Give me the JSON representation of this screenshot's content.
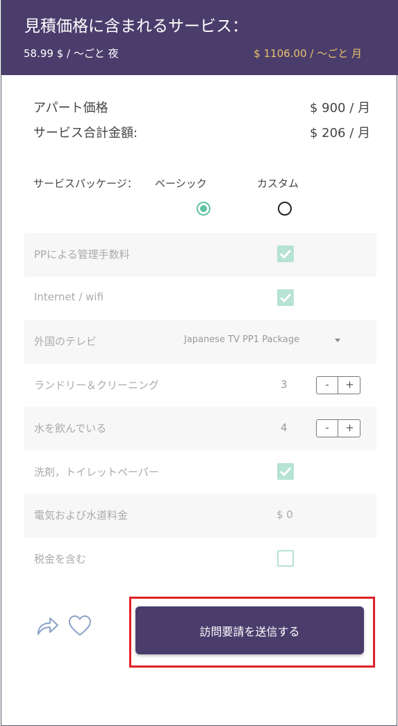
{
  "header": {
    "title": "見積価格に含まれるサービス：",
    "price_per_night": "58.99 $ / ～ごと 夜",
    "price_per_month": "$ 1106.00 / ～ごと 月"
  },
  "summary": {
    "apartment_label": "アパート価格",
    "apartment_value": "$ 900 / 月",
    "services_label": "サービス合計金額:",
    "services_value": "$ 206 / 月"
  },
  "package": {
    "label": "サービスパッケージ：",
    "basic_label": "ベーシック",
    "custom_label": "カスタム",
    "selected": "basic"
  },
  "services": [
    {
      "label": "PPによる管理手数料",
      "type": "checkbox",
      "checked": true
    },
    {
      "label": "Internet / wifi",
      "type": "checkbox",
      "checked": true
    },
    {
      "label": "外国のテレビ",
      "type": "select",
      "value": "Japanese TV PP1 Package"
    },
    {
      "label": "ランドリー＆クリーニング",
      "type": "stepper",
      "count": "3",
      "minus": "-",
      "plus": "+"
    },
    {
      "label": "水を飲んでいる",
      "type": "stepper",
      "count": "4",
      "minus": "-",
      "plus": "+"
    },
    {
      "label": "洗剤，トイレットペーパー",
      "type": "checkbox",
      "checked": true
    },
    {
      "label": "電気および水道料金",
      "type": "value",
      "value": "$ 0"
    },
    {
      "label": "税金を含む",
      "type": "checkbox",
      "checked": false
    }
  ],
  "actions": {
    "submit_label": "訪問要請を送信する",
    "share_icon": "share-icon",
    "favorite_icon": "heart-icon"
  },
  "colors": {
    "brand": "#4a3d6c",
    "accent_gold": "#e9c26a",
    "check_green": "#b6e3d3",
    "radio_green": "#5ec3a0",
    "highlight_red": "#e02027"
  }
}
